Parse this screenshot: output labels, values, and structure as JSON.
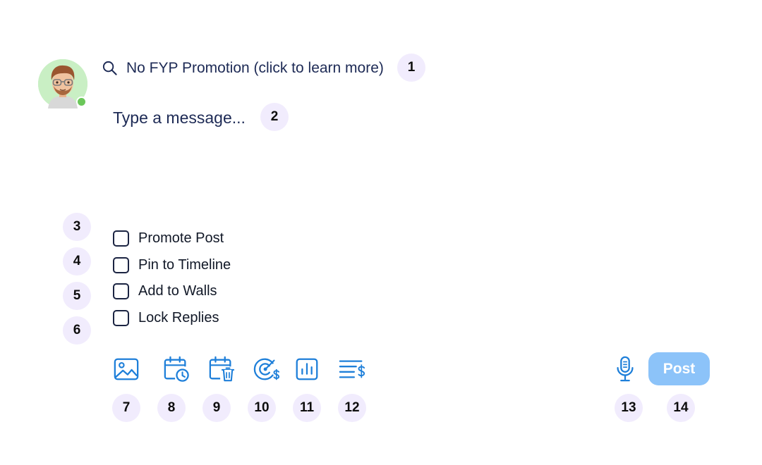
{
  "colors": {
    "icon_blue": "#1e7fd9",
    "post_button": "#8cc3f9",
    "online_status": "#6bc75a",
    "badge_bg": "#f1ecfd"
  },
  "header": {
    "search_label": "No FYP Promotion (click to learn more)",
    "search_icon": "search-icon"
  },
  "composer": {
    "placeholder": "Type a message..."
  },
  "options": [
    {
      "label": "Promote Post",
      "checked": false
    },
    {
      "label": "Pin to Timeline",
      "checked": false
    },
    {
      "label": "Add to Walls",
      "checked": false
    },
    {
      "label": "Lock Replies",
      "checked": false
    }
  ],
  "toolbar": {
    "icons": [
      "image-icon",
      "schedule-post-icon",
      "schedule-delete-icon",
      "target-price-icon",
      "poll-chart-icon",
      "price-list-icon"
    ],
    "mic_icon": "microphone-icon",
    "post_label": "Post"
  },
  "badges": [
    "1",
    "2",
    "3",
    "4",
    "5",
    "6",
    "7",
    "8",
    "9",
    "10",
    "11",
    "12",
    "13",
    "14"
  ]
}
